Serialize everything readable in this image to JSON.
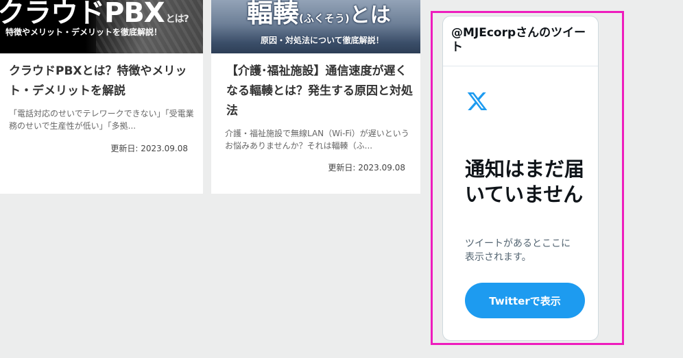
{
  "articles": [
    {
      "thumb_title": "クラウドPBX",
      "thumb_title_suffix": "とは?",
      "thumb_sub": "特徴やメリット・デメリットを徹底解説！",
      "title": "クラウドPBXとは？特徴やメリット・デメリットを解説",
      "description": "「電話対応のせいでテレワークできない」「受電業務のせいで生産性が低い」「多拠...",
      "date": "更新日: 2023.09.08"
    },
    {
      "thumb_title": "輻輳",
      "thumb_title_reading": "(ふくそう)",
      "thumb_title_suffix": "とは",
      "thumb_sub": "原因・対処法について徹底解説！",
      "title": "【介護･福祉施設】通信速度が遅くなる輻輳とは？発生する原因と対処法",
      "description": "介護・福祉施設で無線LAN（Wi-Fi）が遅いというお悩みありませんか？それは輻輳（ふ...",
      "date": "更新日: 2023.09.08"
    }
  ],
  "twitter_widget": {
    "header": "@MJEcorpさんのツイート",
    "logo_icon": "x-logo-icon",
    "empty_title": "通知はまだ届いていません",
    "empty_text": "ツイートがあるとここに表示されます。",
    "button_label": "Twitterで表示",
    "button_color": "#1d9bf0"
  },
  "highlight_color": "#ee1cbd"
}
